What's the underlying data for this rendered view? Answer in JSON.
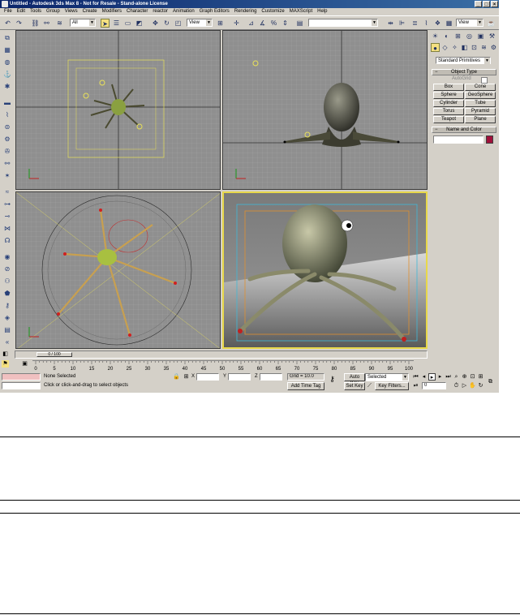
{
  "window": {
    "title": "Untitled - Autodesk 3ds Max 8 - Not for Resale - Stand-alone License",
    "controls": [
      "_",
      "□",
      "×"
    ]
  },
  "menu": [
    "File",
    "Edit",
    "Tools",
    "Group",
    "Views",
    "Create",
    "Modifiers",
    "Character",
    "reactor",
    "Animation",
    "Graph Editors",
    "Rendering",
    "Customize",
    "MAXScript",
    "Help"
  ],
  "toolbar": {
    "selection_filter": "All",
    "reference_coord": "View",
    "named_selection": "",
    "right_view": "View"
  },
  "command_panel": {
    "category": "Standard Primitives",
    "object_type_title": "Object Type",
    "autogrid_label": "AutoGrid",
    "buttons": [
      "Box",
      "Cone",
      "Sphere",
      "GeoSphere",
      "Cylinder",
      "Tube",
      "Torus",
      "Pyramid",
      "Teapot",
      "Plane"
    ],
    "name_color_title": "Name and Color",
    "object_color": "#a0103a"
  },
  "status": {
    "time_slider": "0 / 100",
    "ticks": [
      "0",
      "5",
      "10",
      "15",
      "20",
      "25",
      "30",
      "35",
      "40",
      "45",
      "50",
      "55",
      "60",
      "65",
      "70",
      "75",
      "80",
      "85",
      "90",
      "95",
      "100"
    ],
    "selection": "None Selected",
    "prompt": "Click or click-and-drag to select objects",
    "x_label": "X",
    "y_label": "Y",
    "z_label": "Z",
    "grid": "Grid = 10.0",
    "add_time_tag": "Add Time Tag",
    "auto_key": "Auto Key",
    "set_key": "Set Key",
    "key_mode": "Selected",
    "key_filters": "Key Filters...",
    "current_frame": "0"
  },
  "colors": {
    "ui_gray": "#d4d0c8",
    "viewport_gray": "#8f8f8f",
    "active_viewport": "#e8d84a",
    "title_blue": "#0a246a"
  }
}
